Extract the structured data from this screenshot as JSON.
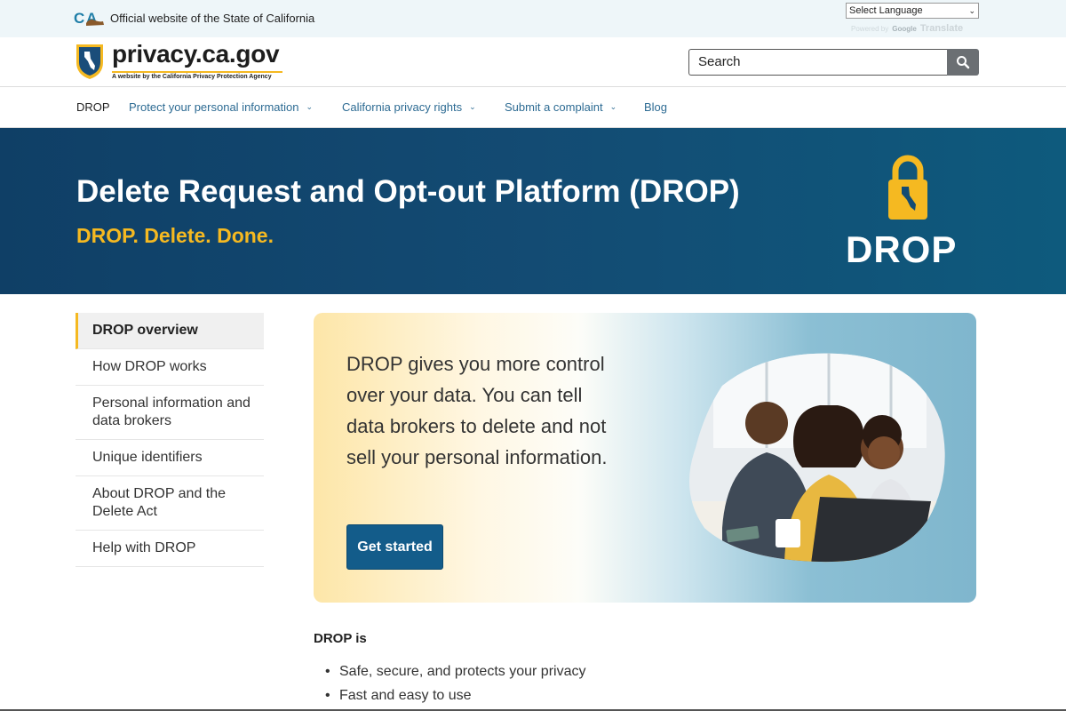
{
  "utility": {
    "official_text": "Official website of the State of California",
    "language_select": "Select Language",
    "powered_by": "Powered by",
    "google": "Google",
    "translate": "Translate"
  },
  "branding": {
    "site_name": "privacy.ca.gov",
    "site_sub": "A website by the California Privacy Protection Agency",
    "search_placeholder": "Search"
  },
  "nav": {
    "items": [
      {
        "label": "DROP"
      },
      {
        "label": "Protect your personal information"
      },
      {
        "label": "California privacy rights"
      },
      {
        "label": "Submit a complaint"
      },
      {
        "label": "Blog"
      }
    ]
  },
  "hero": {
    "title": "Delete Request and Opt-out Platform (DROP)",
    "tagline": "DROP. Delete. Done.",
    "logo_word": "DROP"
  },
  "sidebar": {
    "items": [
      {
        "label": "DROP overview"
      },
      {
        "label": "How DROP works"
      },
      {
        "label": "Personal information and data brokers"
      },
      {
        "label": "Unique identifiers"
      },
      {
        "label": "About DROP and the Delete Act"
      },
      {
        "label": "Help with DROP"
      }
    ]
  },
  "card": {
    "text": "DROP gives you more control over your data. You can tell data brokers to delete and not sell your personal information.",
    "button": "Get started"
  },
  "content": {
    "heading": "DROP is",
    "bullets": [
      "Safe, secure, and protects your privacy",
      "Fast and easy to use"
    ]
  },
  "colors": {
    "hero_bg": "#134b73",
    "accent_gold": "#f5b921",
    "link_blue": "#2d6b93",
    "button_blue": "#135c8a"
  }
}
